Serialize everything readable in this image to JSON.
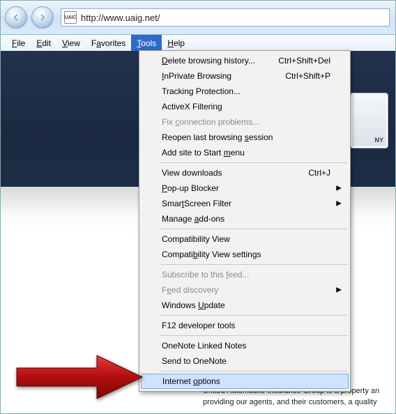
{
  "nav": {
    "url": "http://www.uaig.net/",
    "favicon_text": "UAIC"
  },
  "menubar": {
    "file": "File",
    "file_u": "F",
    "edit": "Edit",
    "edit_u": "E",
    "view": "View",
    "view_u": "V",
    "favorites": "Favorites",
    "favorites_u": "a",
    "tools": "Tools",
    "tools_u": "T",
    "help": "Help",
    "help_u": "H"
  },
  "dropdown": {
    "delete_history": "Delete browsing history...",
    "delete_u": "D",
    "delete_sc": "Ctrl+Shift+Del",
    "inprivate": "InPrivate Browsing",
    "inprivate_u": "I",
    "inprivate_sc": "Ctrl+Shift+P",
    "tracking": "Tracking Protection...",
    "activex": "ActiveX Filtering",
    "fix_conn": "Fix connection problems...",
    "fix_u": "c",
    "reopen": "Reopen last browsing session",
    "reopen_u": "s",
    "add_start": "Add site to Start menu",
    "add_u": "m",
    "view_dl": "View downloads",
    "view_dl_sc": "Ctrl+J",
    "popup": "Pop-up Blocker",
    "popup_u": "P",
    "smartscreen": "SmartScreen Filter",
    "smartscreen_u": "t",
    "addons": "Manage add-ons",
    "addons_u": "a",
    "compat_view": "Compatibility View",
    "compat_settings": "Compatibility View settings",
    "compat_u": "b",
    "subscribe": "Subscribe to this feed...",
    "subscribe_u": "f",
    "feed_disc": "Feed discovery",
    "feed_u": "e",
    "win_update": "Windows Update",
    "win_u": "U",
    "f12": "F12 developer tools",
    "onenote_linked": "OneNote Linked Notes",
    "send_onenote": "Send to OneNote",
    "internet_options": "Internet options",
    "internet_u": "o"
  },
  "page": {
    "badge": "NY",
    "body_line1": "United Automobile Insurance Group is a property an",
    "body_line2": "providing our agents, and their customers, a quality"
  }
}
